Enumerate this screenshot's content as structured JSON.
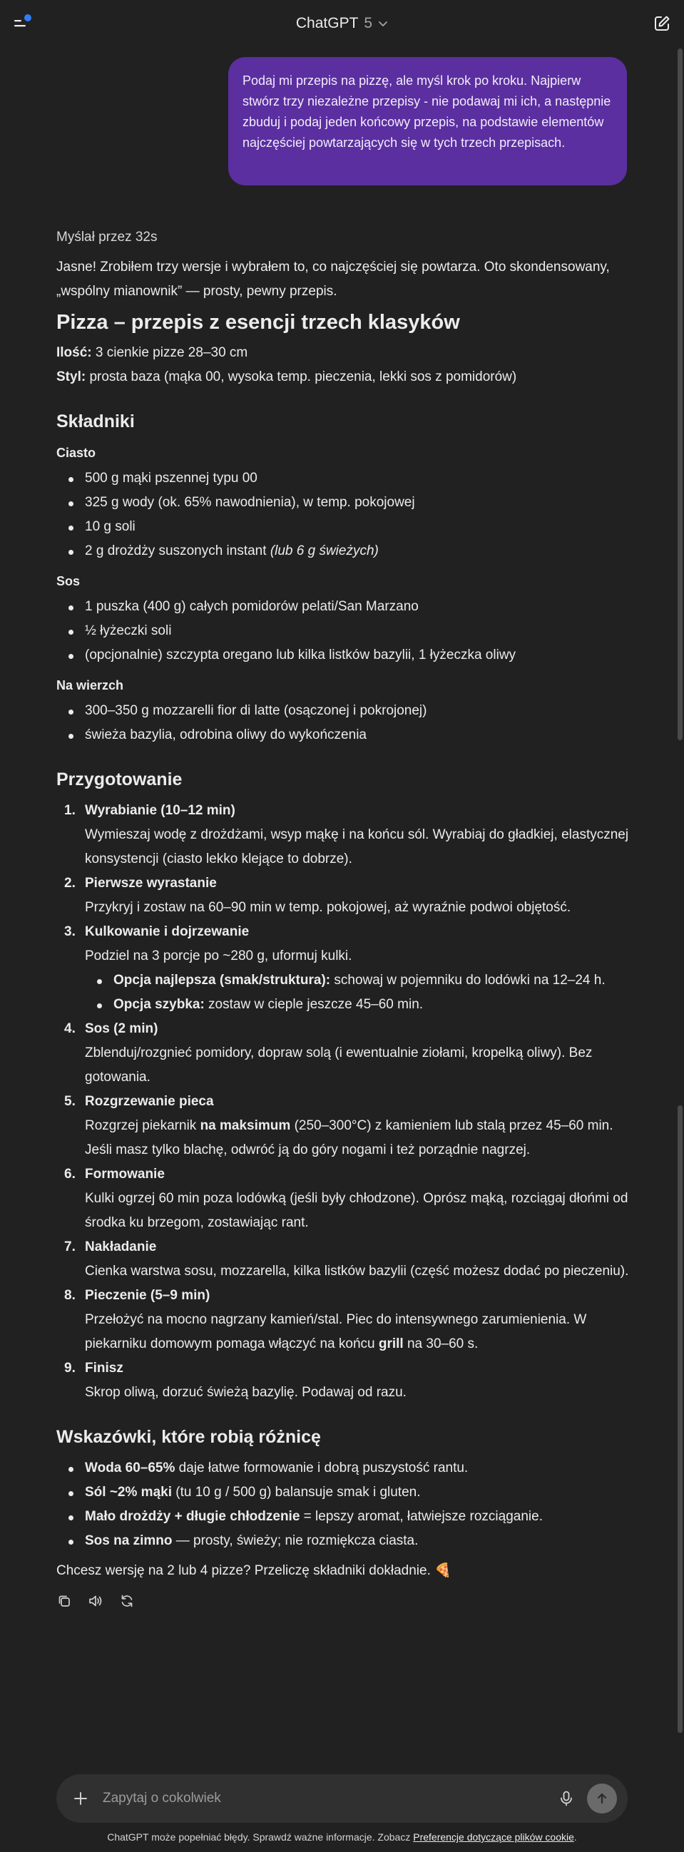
{
  "header": {
    "model_name": "ChatGPT",
    "model_version": "5"
  },
  "user_message": "Podaj mi przepis na pizzę, ale myśl krok po kroku. Najpierw stwórz trzy niezależne przepisy - nie podawaj mi ich, a następnie zbuduj i podaj jeden końcowy przepis, na podstawie elementów najczęściej powtarzających się w tych trzech przepisach.",
  "assistant": {
    "thought_time": "Myślał przez 32s",
    "intro": "Jasne! Zrobiłem trzy wersje i wybrałem to, co najczęściej się powtarza. Oto skondensowany, „wspólny mianownik” — prosty, pewny przepis.",
    "title": "Pizza – przepis z esencji trzech klasyków",
    "amount_label": "Ilość:",
    "amount_value": " 3 cienkie pizze 28–30 cm",
    "style_label": "Styl:",
    "style_value": " prosta baza (mąka 00, wysoka temp. pieczenia, lekki sos z pomidorów)",
    "ingredients_heading": "Składniki",
    "dough_heading": "Ciasto",
    "dough_items": [
      "500 g mąki pszennej typu 00",
      "325 g wody (ok. 65% nawodnienia), w temp. pokojowej",
      "10 g soli",
      "2 g drożdży suszonych instant "
    ],
    "dough_item4_note": "(lub 6 g świeżych)",
    "sauce_heading": "Sos",
    "sauce_items": [
      "1 puszka (400 g) całych pomidorów pelati/San Marzano",
      "½ łyżeczki soli",
      "(opcjonalnie) szczypta oregano lub kilka listków bazylii, 1 łyżeczka oliwy"
    ],
    "topping_heading": "Na wierzch",
    "topping_items": [
      "300–350 g mozzarelli fior di latte (osączonej i pokrojonej)",
      "świeża bazylia, odrobina oliwy do wykończenia"
    ],
    "prep_heading": "Przygotowanie",
    "steps": [
      {
        "num": "1.",
        "title": "Wyrabianie (10–12 min)",
        "body": "Wymieszaj wodę z drożdżami, wsyp mąkę i na końcu sól. Wyrabiaj do gładkiej, elastycznej konsystencji (ciasto lekko klejące to dobrze)."
      },
      {
        "num": "2.",
        "title": "Pierwsze wyrastanie",
        "body": "Przykryj i zostaw na 60–90 min w temp. pokojowej, aż wyraźnie podwoi objętość."
      },
      {
        "num": "3.",
        "title": "Kulkowanie i dojrzewanie",
        "body": "Podziel na 3 porcje po ~280 g, uformuj kulki."
      },
      {
        "num": "4.",
        "title": "Sos (2 min)",
        "body": "Zblenduj/rozgnieć pomidory, dopraw solą (i ewentualnie ziołami, kropelką oliwy). Bez gotowania."
      },
      {
        "num": "5.",
        "title": "Rozgrzewanie pieca",
        "body_a": "Rozgrzej piekarnik ",
        "body_bold": "na maksimum",
        "body_b": " (250–300°C) z kamieniem lub stalą przez 45–60 min. Jeśli masz tylko blachę, odwróć ją do góry nogami i też porządnie nagrzej."
      },
      {
        "num": "6.",
        "title": "Formowanie",
        "body": "Kulki ogrzej 60 min poza lodówką (jeśli były chłodzone). Oprósz mąką, rozciągaj dłońmi od środka ku brzegom, zostawiając rant."
      },
      {
        "num": "7.",
        "title": "Nakładanie",
        "body": "Cienka warstwa sosu, mozzarella, kilka listków bazylii (część możesz dodać po pieczeniu)."
      },
      {
        "num": "8.",
        "title": "Pieczenie (5–9 min)",
        "body_a": "Przełożyć na mocno nagrzany kamień/stal. Piec do intensywnego zarumienienia. W piekarniku domowym pomaga włączyć na końcu ",
        "body_bold": "grill",
        "body_b": " na 30–60 s."
      },
      {
        "num": "9.",
        "title": "Finisz",
        "body": "Skrop oliwą, dorzuć świeżą bazylię. Podawaj od razu."
      }
    ],
    "step3_options": [
      {
        "label": "Opcja najlepsza (smak/struktura):",
        "text": " schowaj w pojemniku do lodówki na 12–24 h."
      },
      {
        "label": "Opcja szybka:",
        "text": " zostaw w cieple jeszcze 45–60 min."
      }
    ],
    "tips_heading": "Wskazówki, które robią różnicę",
    "tips": [
      {
        "bold": "Woda 60–65%",
        "text": " daje łatwe formowanie i dobrą puszystość rantu."
      },
      {
        "bold": "Sól ~2% mąki",
        "text": " (tu 10 g / 500 g) balansuje smak i gluten."
      },
      {
        "bold": "Mało drożdży + długie chłodzenie",
        "text": " = lepszy aromat, łatwiejsze rozciąganie."
      },
      {
        "bold": "Sos na zimno",
        "text": " — prosty, świeży; nie rozmiękcza ciasta."
      }
    ],
    "closing": "Chcesz wersję na 2 lub 4 pizze? Przeliczę składniki dokładnie. 🍕"
  },
  "composer": {
    "placeholder": "Zapytaj o cokolwiek"
  },
  "footer": {
    "disclaimer": "ChatGPT może popełniać błędy. Sprawdź ważne informacje. Zobacz ",
    "link": "Preferencje dotyczące plików cookie",
    "end": "."
  },
  "colors": {
    "background": "#212121",
    "user_bubble": "#5b2fa0",
    "composer": "#303030",
    "notification_dot": "#2f7df6"
  }
}
